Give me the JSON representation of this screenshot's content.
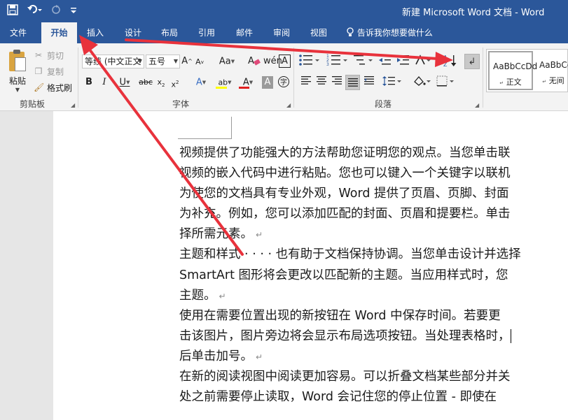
{
  "window": {
    "title": "新建 Microsoft Word 文档  -  Word"
  },
  "tabs": {
    "file": "文件",
    "home": "开始",
    "insert": "插入",
    "design": "设计",
    "layout": "布局",
    "references": "引用",
    "mailings": "邮件",
    "review": "审阅",
    "view": "视图",
    "tell_me": "告诉我你想要做什么"
  },
  "clipboard": {
    "paste": "粘贴",
    "cut": "剪切",
    "copy": "复制",
    "format_painter": "格式刷",
    "group_label": "剪贴板"
  },
  "font": {
    "name": "等线 (中文正文",
    "size": "五号",
    "group_label": "字体"
  },
  "paragraph": {
    "group_label": "段落"
  },
  "styles": {
    "items": [
      {
        "sample": "AaBbCcDd",
        "name": "正文"
      },
      {
        "sample": "AaBbCcDd",
        "name": "无间"
      }
    ]
  },
  "doc": {
    "lines": [
      "视频提供了功能强大的方法帮助您证明您的观点。当您单击联",
      "视频的嵌入代码中进行粘贴。您也可以键入一个关键字以联机",
      "为使您的文档具有专业外观，Word 提供了页眉、页脚、封面",
      "为补充。例如，您可以添加匹配的封面、页眉和提要栏。单击",
      "择所需元素。",
      "主题和样式 · · · · 也有助于文档保持协调。当您单击设计并选择",
      "SmartArt 图形将会更改以匹配新的主题。当应用样式时，您",
      "主题。",
      "使用在需要位置出现的新按钮在 Word 中保存时间。若要更",
      "击该图片，图片旁边将会显示布局选项按钮。当处理表格时，",
      "后单击加号。",
      "在新的阅读视图中阅读更加容易。可以折叠文档某些部分并关",
      "处之前需要停止读取，Word 会记住您的停止位置 - 即使在"
    ],
    "paragraph_mark": "↵"
  },
  "colors": {
    "accent": "#2b579a",
    "annotation_arrow": "#e8323c"
  }
}
